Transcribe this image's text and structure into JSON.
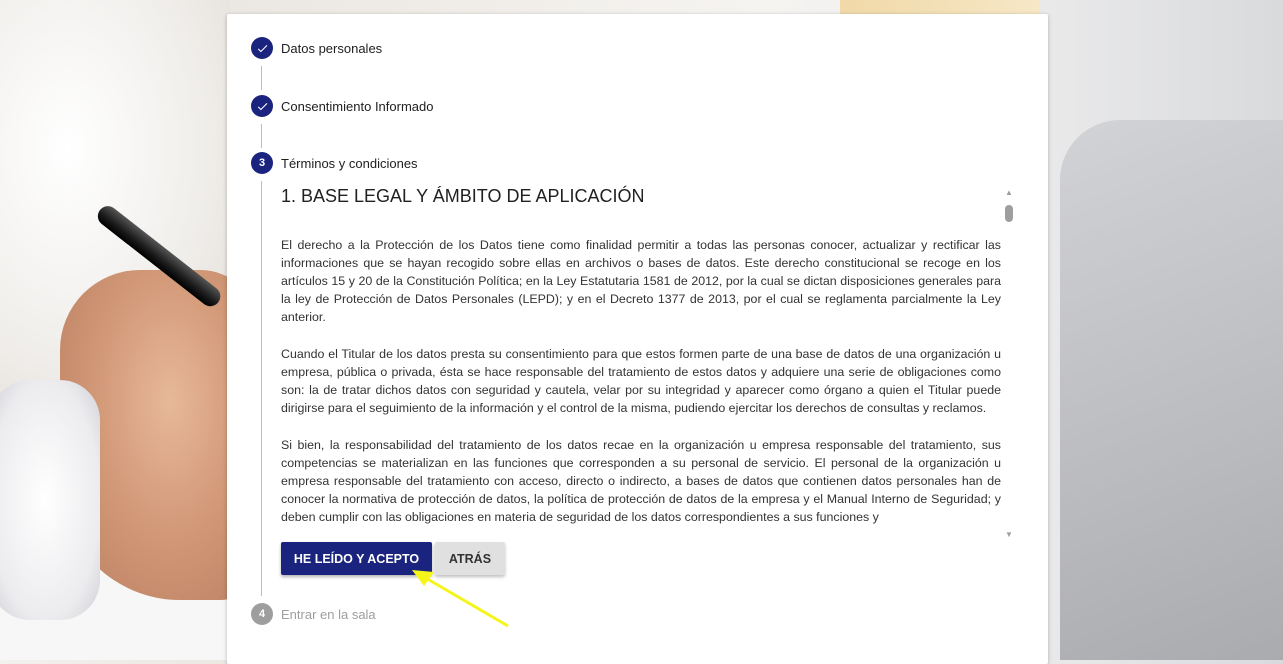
{
  "steps": [
    {
      "number": "1",
      "label": "Datos personales",
      "status": "completed"
    },
    {
      "number": "2",
      "label": "Consentimiento Informado",
      "status": "completed"
    },
    {
      "number": "3",
      "label": "Términos y condiciones",
      "status": "active"
    },
    {
      "number": "4",
      "label": "Entrar en la sala",
      "status": "pending"
    }
  ],
  "terms": {
    "title": "1. BASE LEGAL Y ÁMBITO DE APLICACIÓN",
    "paragraphs": [
      "El derecho a la Protección de los Datos tiene como finalidad permitir a todas las personas conocer, actualizar y rectificar las informaciones que se hayan recogido sobre ellas en archivos o bases de datos. Este derecho constitucional se recoge en los artículos 15 y 20 de la Constitución Política; en la Ley Estatutaria 1581 de 2012, por la cual se dictan disposiciones generales para la ley de Protección de Datos Personales (LEPD); y en el Decreto 1377 de 2013, por el cual se reglamenta parcialmente la Ley anterior.",
      "Cuando el Titular de los datos presta su consentimiento para que estos formen parte de una base de datos de una organización u empresa, pública o privada, ésta se hace responsable del tratamiento de estos datos y adquiere una serie de obligaciones como son: la de tratar dichos datos con seguridad y cautela, velar por su integridad y aparecer como órgano a quien el Titular puede dirigirse para el seguimiento de la información y el control de la misma, pudiendo ejercitar los derechos de consultas y reclamos.",
      "Si bien, la responsabilidad del tratamiento de los datos recae en la organización u empresa responsable del tratamiento, sus competencias se materializan en las funciones que corresponden a su personal de servicio. El personal de la organización u empresa responsable del tratamiento con acceso, directo o indirecto, a bases de datos que contienen datos personales han de conocer la normativa de protección de datos, la política de protección de datos de la empresa y el Manual Interno de Seguridad; y deben cumplir con las obligaciones en materia de seguridad de los datos correspondientes a sus funciones y"
    ]
  },
  "buttons": {
    "accept": "HE LEÍDO Y ACEPTO",
    "back": "ATRÁS"
  },
  "colors": {
    "primary": "#1a237e",
    "inactive": "#9e9e9e",
    "annotation": "#f5f51a"
  },
  "icons": {
    "completed": "check-icon",
    "scroll_up": "triangle-up-icon",
    "scroll_down": "triangle-down-icon"
  }
}
